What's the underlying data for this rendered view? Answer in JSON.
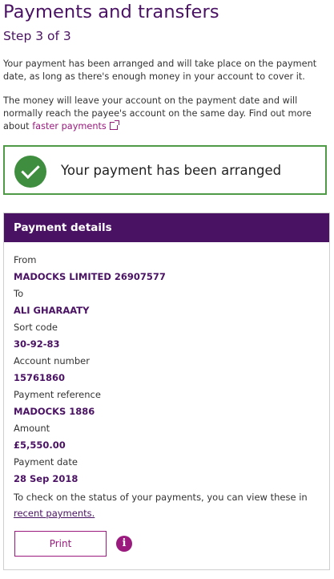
{
  "page": {
    "title": "Payments and transfers",
    "step": "Step 3 of 3",
    "intro": "Your payment has been arranged and will take place on the payment date, as long as there's enough money in your account to cover it.",
    "info_text": "The money will leave your account on the payment date and will normally reach the payee's account on the same day. Find out more about",
    "info_link": "faster payments"
  },
  "alert": {
    "message": "Your payment has been arranged",
    "color": "#3f8e3f"
  },
  "details": {
    "header": "Payment details",
    "rows": [
      {
        "label": "From",
        "value": "MADOCKS LIMITED 26907577"
      },
      {
        "label": "To",
        "value": "ALI GHARAATY"
      },
      {
        "label": "Sort code",
        "value": "30-92-83"
      },
      {
        "label": "Account number",
        "value": "15761860"
      },
      {
        "label": "Payment reference",
        "value": "MADOCKS 1886"
      },
      {
        "label": "Amount",
        "value": "£5,550.00"
      },
      {
        "label": "Payment date",
        "value": "28 Sep 2018"
      }
    ],
    "status_note": "To check on the status of your payments, you can view these in",
    "status_link": "recent payments."
  },
  "actions": {
    "print_label": "Print",
    "info_glyph": "i"
  },
  "theme": {
    "brand": "#4a1263",
    "accent": "#9a1a7e",
    "success": "#4e9a47"
  }
}
